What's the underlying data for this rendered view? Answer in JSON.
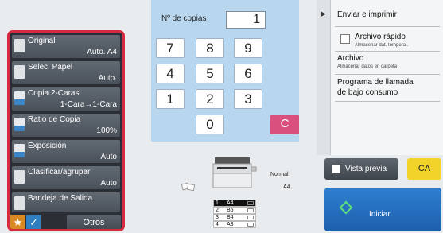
{
  "left_panel": {
    "items": [
      {
        "title": "Original",
        "value": "Auto.  A4"
      },
      {
        "title": "Selec. Papel",
        "value": "Auto."
      },
      {
        "title": "Copia 2-Caras",
        "value": "1-Cara→1-Cara"
      },
      {
        "title": "Ratio de Copia",
        "value": "100%"
      },
      {
        "title": "Exposición",
        "value": "Auto"
      },
      {
        "title": "Clasificar/agrupar",
        "value": "Auto"
      },
      {
        "title": "Bandeja de Salida",
        "value": ""
      }
    ],
    "star_glyph": "★",
    "check_glyph": "✓",
    "otros_label": "Otros"
  },
  "keypad": {
    "copies_label": "Nº de copias",
    "copies_value": "1",
    "keys": [
      "7",
      "8",
      "9",
      "4",
      "5",
      "6",
      "1",
      "2",
      "3",
      "0"
    ],
    "clear_label": "C"
  },
  "machine": {
    "paper_type": "Normal",
    "paper_size": "A4",
    "trays": [
      {
        "num": "1",
        "size": "A4"
      },
      {
        "num": "2",
        "size": "B5"
      },
      {
        "num": "3",
        "size": "B4"
      },
      {
        "num": "4",
        "size": "A3"
      }
    ],
    "selected_tray": 1
  },
  "right_panel": {
    "collapse_glyph": "▶",
    "send_print": "Enviar e imprimir",
    "quick_file": "Archivo rápido",
    "quick_file_sub": "Almacenar dat. temporal.",
    "file": "Archivo",
    "file_sub": "Almacenar datos en carpeta",
    "low_power_1": "Programa de llamada",
    "low_power_2": "de bajo consumo"
  },
  "actions": {
    "preview_label": "Vista previa",
    "ca_label": "CA",
    "start_label": "Iniciar"
  },
  "colors": {
    "accent_red": "#d52a3f",
    "keypad_bg": "#b8d7ef",
    "clear_key": "#d94f7d",
    "ca_yellow": "#f1d32a",
    "start_blue": "#1c5fad"
  }
}
